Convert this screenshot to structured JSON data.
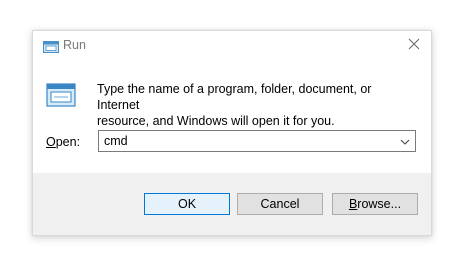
{
  "window": {
    "title": "Run",
    "title_icon": "run-icon",
    "close_icon": "close-icon"
  },
  "main": {
    "icon": "run-icon",
    "description_line1": "Type the name of a program, folder, document, or Internet",
    "description_line2": "resource, and Windows will open it for you."
  },
  "open": {
    "label_mnemonic": "O",
    "label_rest": "pen:",
    "value": "cmd",
    "dropdown_icon": "chevron-down-icon"
  },
  "buttons": {
    "ok": "OK",
    "cancel": "Cancel",
    "browse_mnemonic": "B",
    "browse_rest": "rowse..."
  },
  "colors": {
    "accent": "#0078d7",
    "footer_bg": "#f0f0f0",
    "button_bg": "#e1e1e1"
  }
}
